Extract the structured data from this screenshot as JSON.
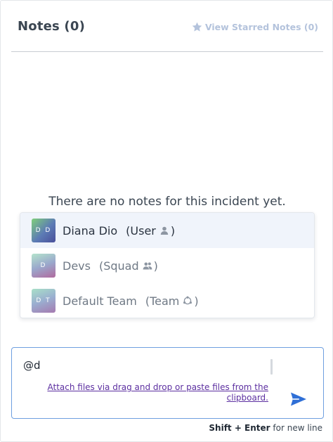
{
  "header": {
    "title": "Notes (0)",
    "starred_label": "View Starred Notes (0)",
    "star_color": "#b4c3dc"
  },
  "empty_state": {
    "message": "There are no notes for this incident yet."
  },
  "mention_suggestions": [
    {
      "initials": "D D",
      "name": "Diana Dio",
      "type_label": "(User",
      "type_close": ")",
      "type_icon": "user-icon",
      "highlighted": true
    },
    {
      "initials": "D",
      "name": "Devs",
      "type_label": "(Squad",
      "type_close": ")",
      "type_icon": "squad-icon",
      "highlighted": false
    },
    {
      "initials": "D T",
      "name": "Default Team",
      "type_label": "(Team",
      "type_close": ")",
      "type_icon": "team-icon",
      "highlighted": false
    }
  ],
  "composer": {
    "value": "@d",
    "attach_label": "Attach files via drag and drop or paste files from the clipboard.",
    "send_icon": "send-icon",
    "border_color": "#6e9fe0",
    "send_color": "#2f6fd6"
  },
  "hint": {
    "keys": "Shift + Enter",
    "text": " for new line"
  }
}
